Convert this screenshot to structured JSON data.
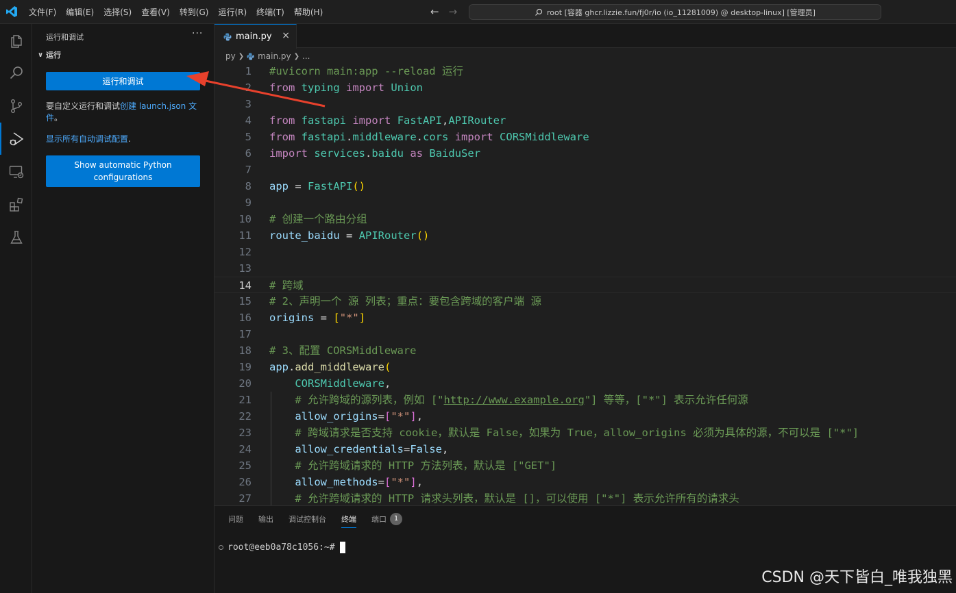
{
  "titlebar": {
    "menu": [
      "文件(F)",
      "编辑(E)",
      "选择(S)",
      "查看(V)",
      "转到(G)",
      "运行(R)",
      "终端(T)",
      "帮助(H)"
    ],
    "command_center": "root [容器 ghcr.lizzie.fun/fj0r/io (io_11281009) @ desktop-linux] [管理员]"
  },
  "activitybar": {
    "items": [
      "files-icon",
      "search-icon",
      "source-control-icon",
      "run-debug-icon",
      "remote-explorer-icon",
      "extensions-icon",
      "testing-icon"
    ],
    "active": "run-debug-icon"
  },
  "sidebar": {
    "title": "运行和调试",
    "more": "···",
    "section": "运行",
    "run_button": "运行和调试",
    "customize_text": "要自定义运行和调试",
    "customize_link": "创建 launch.json 文件",
    "customize_end": "。",
    "show_link": "显示所有自动调试配置",
    "show_end": ".",
    "python_button": "Show automatic Python configurations"
  },
  "editor": {
    "tab_label": "main.py",
    "close_icon": "×",
    "breadcrumb": [
      "py",
      "main.py",
      "..."
    ],
    "current_line": 14
  },
  "panel": {
    "tabs": [
      "问题",
      "输出",
      "调试控制台",
      "终端",
      "端口"
    ],
    "active_tab": "终端",
    "ports_badge": "1",
    "terminal_prompt": "root@eeb0a78c1056:~#"
  },
  "watermark": "CSDN @天下皆白_唯我独黑",
  "colors": {
    "accent": "#0078d4",
    "link": "#4daafc",
    "arrow": "#e8412c"
  }
}
